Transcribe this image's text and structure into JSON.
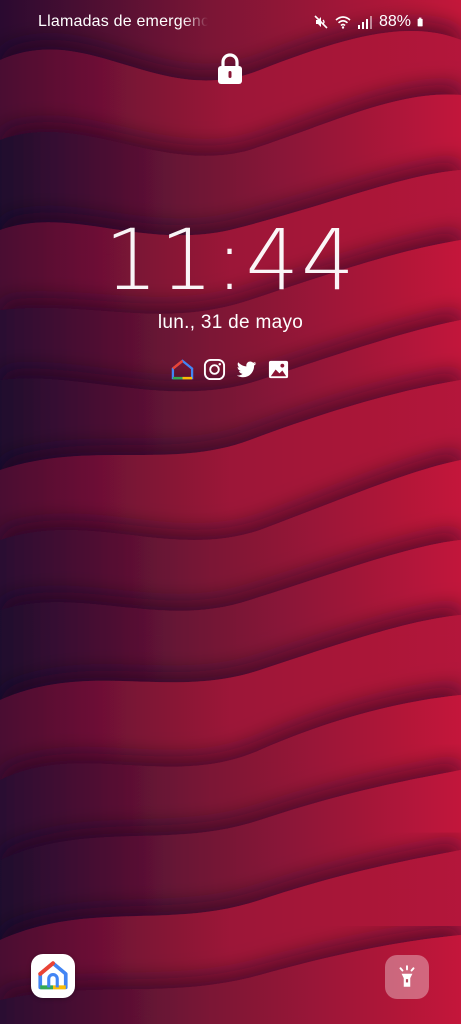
{
  "status_bar": {
    "carrier_text": "Llamadas de emergencia",
    "battery": "88%",
    "icons": [
      "mute-icon",
      "wifi-icon",
      "signal-icon",
      "battery-icon"
    ]
  },
  "lock_screen": {
    "lock_icon": "padlock-icon",
    "time": "11:44",
    "date": "lun., 31 de mayo",
    "notification_icons": [
      "google-home-icon",
      "instagram-icon",
      "twitter-icon",
      "gallery-icon"
    ]
  },
  "shortcuts": {
    "left": "google-home-icon",
    "right": "flashlight-icon"
  },
  "colors": {
    "wallpaper_light": "#c0173a",
    "wallpaper_mid": "#8a1535",
    "wallpaper_dark": "#2a0a30"
  }
}
